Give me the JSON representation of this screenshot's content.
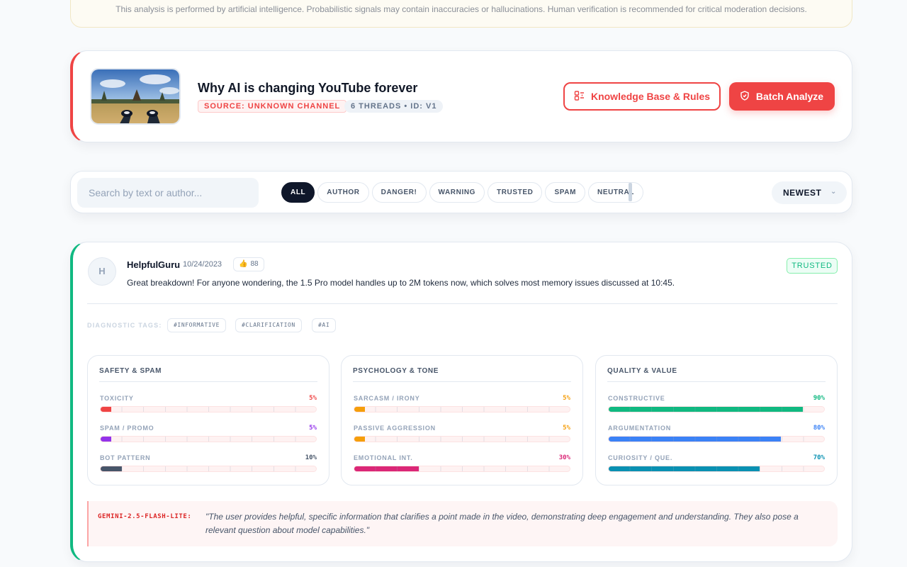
{
  "disclaimer": "This analysis is performed by artificial intelligence. Probabilistic signals may contain inaccuracies or hallucinations. Human verification is recommended for critical moderation decisions.",
  "video": {
    "title": "Why AI is changing YouTube forever",
    "source_badge": "SOURCE: UNKNOWN CHANNEL",
    "threads_badge": "6 THREADS • ID: V1",
    "kb_button": "Knowledge Base & Rules",
    "batch_button": "Batch Analyze",
    "accent": "#ef4444"
  },
  "filters": {
    "search_placeholder": "Search by text or author...",
    "chips": [
      "ALL",
      "AUTHOR",
      "DANGER!",
      "WARNING",
      "TRUSTED",
      "SPAM",
      "NEUTRAL"
    ],
    "active_chip": "ALL",
    "sort_value": "NEWEST"
  },
  "comment": {
    "avatar_initial": "H",
    "author": "HelpfulGuru",
    "date": "10/24/2023",
    "likes": "88",
    "status": "TRUSTED",
    "status_color": "#10b981",
    "text": "Great breakdown! For anyone wondering, the 1.5 Pro model handles up to 2M tokens now, which solves most memory issues discussed at 10:45.",
    "diagnostic_label": "DIAGNOSTIC TAGS:",
    "tags": [
      "#INFORMATIVE",
      "#CLARIFICATION",
      "#AI"
    ],
    "panels": [
      {
        "title": "SAFETY & SPAM",
        "metrics": [
          {
            "label": "TOXICITY",
            "value": "5%",
            "fraction": 0.05,
            "color": "#ef4444"
          },
          {
            "label": "SPAM / PROMO",
            "value": "5%",
            "fraction": 0.05,
            "color": "#9333ea"
          },
          {
            "label": "BOT PATTERN",
            "value": "10%",
            "fraction": 0.1,
            "color": "#475569"
          }
        ]
      },
      {
        "title": "PSYCHOLOGY & TONE",
        "metrics": [
          {
            "label": "SARCASM / IRONY",
            "value": "5%",
            "fraction": 0.05,
            "color": "#f59e0b"
          },
          {
            "label": "PASSIVE AGGRESSION",
            "value": "5%",
            "fraction": 0.05,
            "color": "#f59e0b"
          },
          {
            "label": "EMOTIONAL INT.",
            "value": "30%",
            "fraction": 0.3,
            "color": "#db2777"
          }
        ]
      },
      {
        "title": "QUALITY & VALUE",
        "metrics": [
          {
            "label": "CONSTRUCTIVE",
            "value": "90%",
            "fraction": 0.9,
            "color": "#10b981"
          },
          {
            "label": "ARGUMENTATION",
            "value": "80%",
            "fraction": 0.8,
            "color": "#3b82f6"
          },
          {
            "label": "CURIOSITY / QUE.",
            "value": "70%",
            "fraction": 0.7,
            "color": "#0891b2"
          }
        ]
      }
    ],
    "ai": {
      "model": "GEMINI-2.5-FLASH-LITE:",
      "text": "\"The user provides helpful, specific information that clarifies a point made in the video, demonstrating deep engagement and understanding. They also pose a relevant question about model capabilities.\""
    }
  }
}
